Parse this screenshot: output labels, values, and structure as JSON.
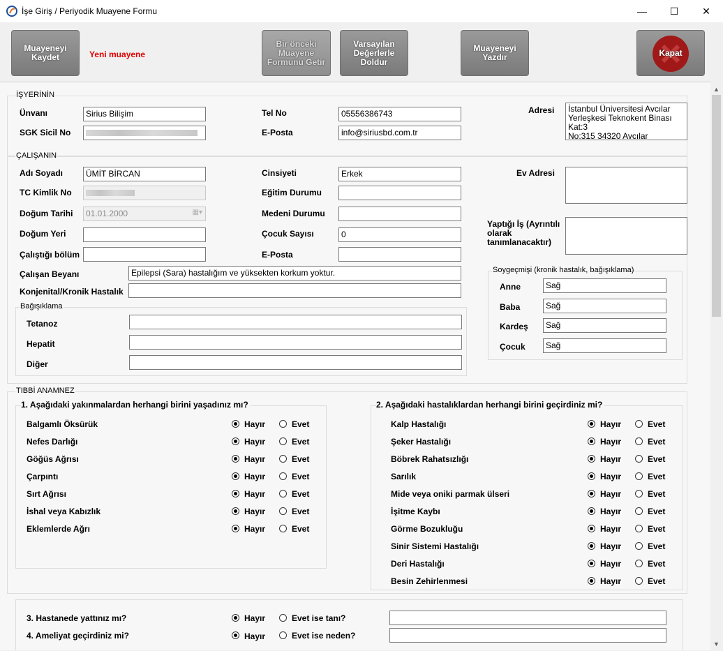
{
  "window": {
    "title": "İşe Giriş / Periyodik Muayene Formu",
    "minimize": "—",
    "maximize": "☐",
    "close": "✕"
  },
  "toolbar": {
    "save_label": "Muayeneyi\nKaydet",
    "status_text": "Yeni muayene",
    "prev_form_label": "Bir önceki\nMuayene\nFormunu Getir",
    "defaults_label": "Varsayılan\nDeğerlerle\nDoldur",
    "print_label": "Muayeneyi\nYazdır",
    "close_label": "Kapat"
  },
  "employer": {
    "section_title": "İŞYERİNİN",
    "title_label": "Ünvanı",
    "title_value": "Sirius Bilişim",
    "sgk_label": "SGK Sicil No",
    "phone_label": "Tel No",
    "phone_value": "05556386743",
    "email_label": "E-Posta",
    "email_value": "info@siriusbd.com.tr",
    "address_label": "Adresi",
    "address_value": "İstanbul Üniversitesi Avcılar\nYerleşkesi Teknokent Binası Kat:3\nNo:315 34320 Avcılar"
  },
  "employee": {
    "section_title": "ÇALIŞANIN",
    "name_label": "Adı Soyadı",
    "name_value": "ÜMİT BİRCAN",
    "tc_label": "TC Kimlik No",
    "birthdate_label": "Doğum Tarihi",
    "birthdate_value": "01.01.2000",
    "birthplace_label": "Doğum Yeri",
    "department_label": "Çalıştığı bölüm",
    "gender_label": "Cinsiyeti",
    "gender_value": "Erkek",
    "education_label": "Eğitim Durumu",
    "marital_label": "Medeni Durumu",
    "children_label": "Çocuk Sayısı",
    "children_value": "0",
    "email_label": "E-Posta",
    "home_address_label": "Ev Adresi",
    "job_label": "Yaptığı İş (Ayrıntılı\nolarak\ntanımlanacaktır)",
    "statement_label": "Çalışan Beyanı",
    "statement_value": "Epilepsi (Sara) hastalığım ve yüksekten korkum yoktur.",
    "congenital_label": "Konjenital/Kronik Hastalık"
  },
  "vaccination": {
    "section_title": "Bağışıklama",
    "tetanus_label": "Tetanoz",
    "hepatitis_label": "Hepatit",
    "other_label": "Diğer"
  },
  "family": {
    "section_title": "Soygeçmişi (kronik hastalık, bağışıklama)",
    "rows": [
      {
        "label": "Anne",
        "value": "Sağ"
      },
      {
        "label": "Baba",
        "value": "Sağ"
      },
      {
        "label": "Kardeş",
        "value": "Sağ"
      },
      {
        "label": "Çocuk",
        "value": "Sağ"
      }
    ]
  },
  "anamnesis": {
    "section_title": "TIBBİ ANAMNEZ",
    "q1_title": "1. Aşağıdaki yakınmalardan herhangi birini yaşadınız mı?",
    "q1_items": [
      "Balgamlı Öksürük",
      "Nefes Darlığı",
      "Göğüs Ağrısı",
      "Çarpıntı",
      "Sırt Ağrısı",
      "İshal veya Kabızlık",
      "Eklemlerde Ağrı"
    ],
    "q2_title": "2. Aşağıdaki hastalıklardan herhangi birini geçirdiniz mi?",
    "q2_items": [
      "Kalp Hastalığı",
      "Şeker Hastalığı",
      "Böbrek Rahatsızlığı",
      "Sarılık",
      "Mide veya oniki parmak ülseri",
      "İşitme Kaybı",
      "Görme Bozukluğu",
      "Sinir Sistemi Hastalığı",
      "Deri Hastalığı",
      "Besin Zehirlenmesi"
    ],
    "no_label": "Hayır",
    "yes_label": "Evet",
    "q3_label": "3. Hastanede yattınız mı?",
    "q3_yes_label": "Evet ise tanı?",
    "q4_label": "4. Ameliyat geçirdiniz mi?",
    "q4_yes_label": "Evet ise neden?"
  }
}
